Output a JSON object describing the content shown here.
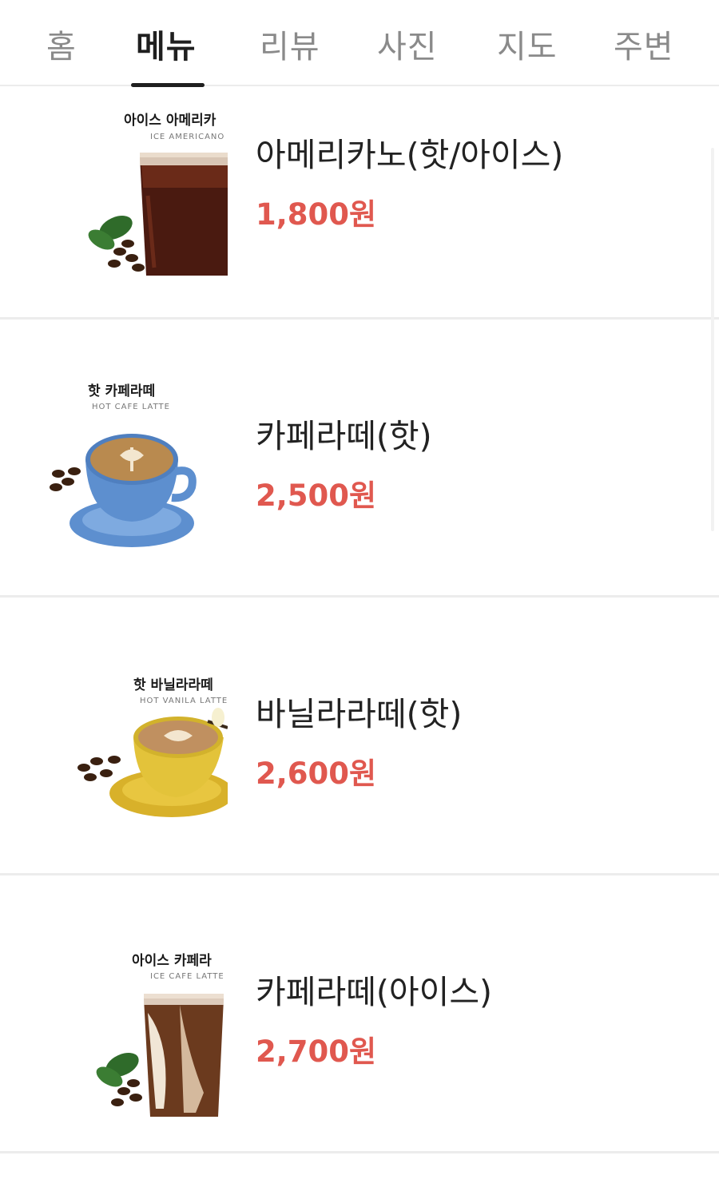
{
  "tabs": [
    {
      "label": "홈"
    },
    {
      "label": "메뉴",
      "active": true
    },
    {
      "label": "리뷰"
    },
    {
      "label": "사진"
    },
    {
      "label": "지도"
    },
    {
      "label": "주변"
    }
  ],
  "menu": {
    "items": [
      {
        "name": "아메리카노(핫/아이스)",
        "price": "1,800원",
        "image_title": "아이스 아메리카",
        "image_subtitle": "ICE AMERICANO"
      },
      {
        "name": "카페라떼(핫)",
        "price": "2,500원",
        "image_title": "핫 카페라떼",
        "image_subtitle": "HOT CAFE LATTE"
      },
      {
        "name": "바닐라라떼(핫)",
        "price": "2,600원",
        "image_title": "핫 바닐라라떼",
        "image_subtitle": "HOT VANILA LATTE"
      },
      {
        "name": "카페라떼(아이스)",
        "price": "2,700원",
        "image_title": "아이스 카페라",
        "image_subtitle": "ICE CAFE LATTE"
      }
    ]
  },
  "colors": {
    "price": "#e0584f",
    "active_tab": "#1f1f1f",
    "inactive_tab": "#8a8a8a",
    "divider": "#ececec"
  }
}
